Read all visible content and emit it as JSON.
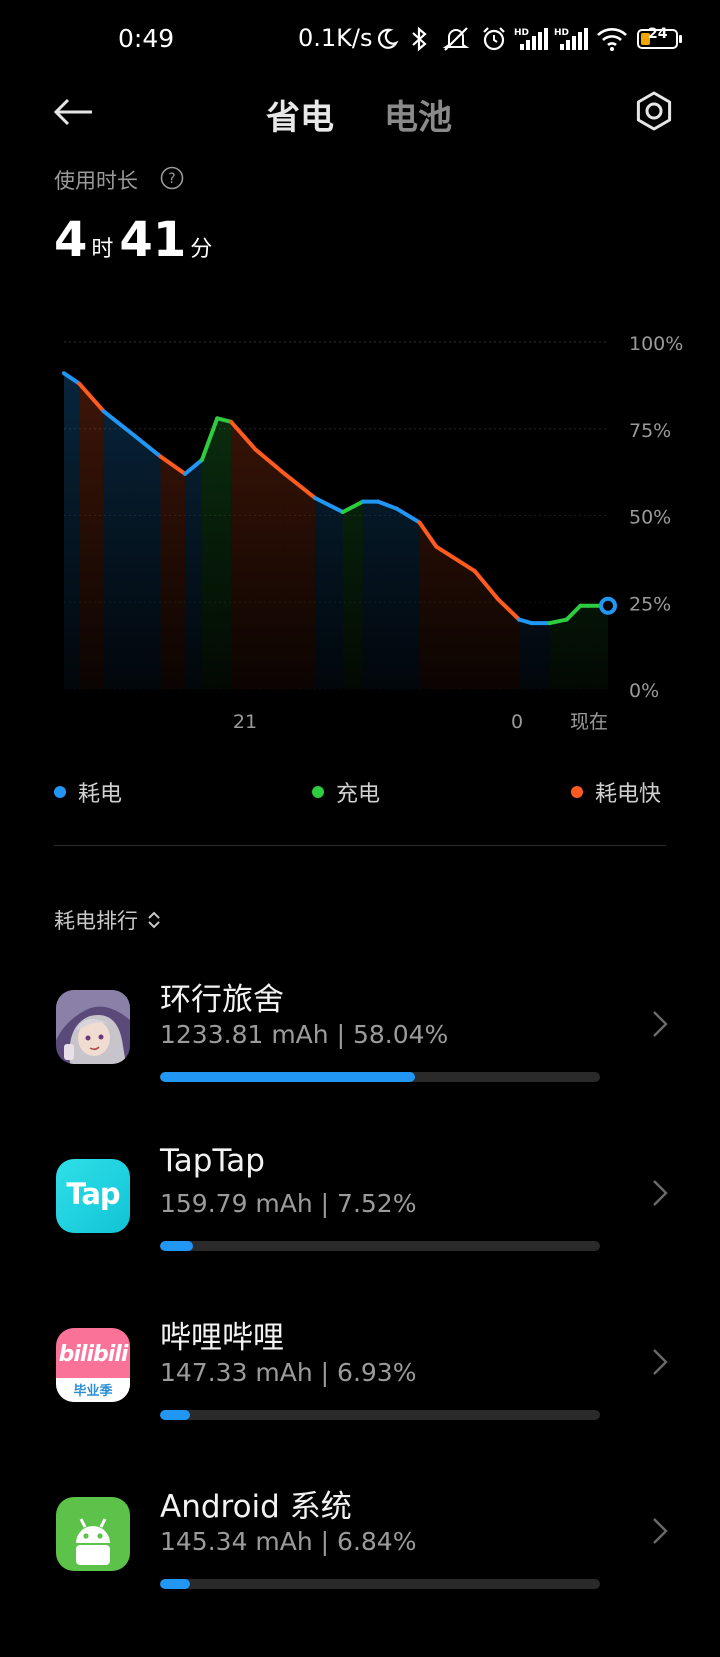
{
  "status_bar": {
    "time": "0:49",
    "network_speed": "0.1K/s",
    "battery_level": "24",
    "icons": [
      "moon-icon",
      "bluetooth-icon",
      "mute-icon",
      "alarm-icon",
      "hd-signal-icon",
      "hd-signal-icon",
      "wifi-icon",
      "battery-icon"
    ]
  },
  "header": {
    "back_icon": "arrow-left-icon",
    "tabs": [
      {
        "label": "省电",
        "active": true
      },
      {
        "label": "电池",
        "active": false
      }
    ],
    "settings_icon": "gear-icon"
  },
  "usage": {
    "label": "使用时长",
    "hours": "4",
    "hours_unit": "时",
    "minutes": "41",
    "minutes_unit": "分"
  },
  "chart_data": {
    "type": "line",
    "y_ticks": [
      "100%",
      "75%",
      "50%",
      "25%",
      "0%"
    ],
    "x_ticks": [
      "21",
      "0",
      "现在"
    ],
    "ylim": [
      0,
      100
    ],
    "grid": true,
    "legend_placement": "bottom",
    "series": [
      {
        "name": "耗电",
        "color": "#2196f3"
      },
      {
        "name": "充电",
        "color": "#2ecc40"
      },
      {
        "name": "耗电快",
        "color": "#ff5a1f"
      }
    ],
    "x": [
      0,
      1,
      2.6,
      4.6,
      6.3,
      7.9,
      9,
      10,
      10.9,
      12.5,
      14.4,
      16.4,
      18.2,
      19.5,
      20.5,
      21.7,
      23.2,
      24.3,
      26.8,
      28.3,
      29.7,
      30.5,
      31.7,
      32.8,
      33.7,
      34.2,
      35,
      35.5
    ],
    "values": [
      91,
      88,
      80,
      73,
      67,
      62,
      66,
      78,
      77,
      69,
      62,
      55,
      51,
      54,
      54,
      52,
      48,
      41,
      34,
      26,
      20,
      19,
      19,
      20,
      24,
      24,
      24,
      24
    ],
    "segment_types": [
      "耗电",
      "耗电快",
      "耗电",
      "耗电",
      "耗电快",
      "耗电",
      "充电",
      "充电",
      "耗电快",
      "耗电快",
      "耗电快",
      "耗电",
      "充电",
      "耗电",
      "耗电",
      "耗电",
      "耗电快",
      "耗电快",
      "耗电快",
      "耗电快",
      "耗电",
      "耗电",
      "充电",
      "充电",
      "充电",
      "充电",
      "充电"
    ]
  },
  "legend": [
    {
      "label": "耗电",
      "color": "#2196f3"
    },
    {
      "label": "充电",
      "color": "#2ecc40"
    },
    {
      "label": "耗电快",
      "color": "#ff5a1f"
    }
  ],
  "ranking": {
    "title": "耗电排行",
    "sort_icon": "sort-arrows-icon",
    "apps": [
      {
        "name": "环行旅舍",
        "stat": "1233.81 mAh | 58.04%",
        "percent": 58.04,
        "icon": "anime-character-app-icon"
      },
      {
        "name": "TapTap",
        "stat": "159.79 mAh | 7.52%",
        "percent": 7.52,
        "icon": "taptap-app-icon",
        "icon_text": "Tap"
      },
      {
        "name": "哔哩哔哩",
        "stat": "147.33 mAh | 6.93%",
        "percent": 6.93,
        "icon": "bilibili-app-icon",
        "icon_text": "bilibili",
        "icon_subtext": "毕业季"
      },
      {
        "name": "Android 系统",
        "stat": "145.34 mAh | 6.84%",
        "percent": 6.84,
        "icon": "android-app-icon"
      }
    ]
  }
}
